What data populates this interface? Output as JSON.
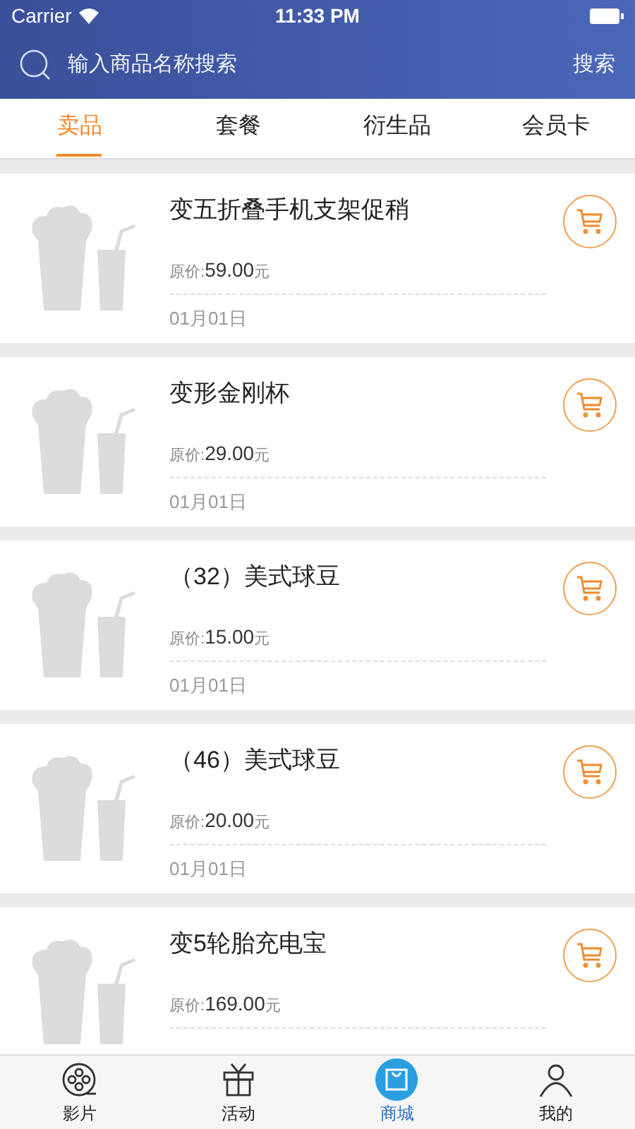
{
  "status_bar": {
    "carrier": "Carrier",
    "time": "11:33 PM"
  },
  "search": {
    "placeholder": "输入商品名称搜索",
    "button": "搜索"
  },
  "tabs": [
    {
      "label": "卖品",
      "selected": true
    },
    {
      "label": "套餐",
      "selected": false
    },
    {
      "label": "衍生品",
      "selected": false
    },
    {
      "label": "会员卡",
      "selected": false
    }
  ],
  "products": [
    {
      "name": "变五折叠手机支架促稍",
      "price_label": "原价:",
      "price": "59.00",
      "unit": "元",
      "date": "01月01日"
    },
    {
      "name": "变形金刚杯",
      "price_label": "原价:",
      "price": "29.00",
      "unit": "元",
      "date": "01月01日"
    },
    {
      "name": "（32）美式球豆",
      "price_label": "原价:",
      "price": "15.00",
      "unit": "元",
      "date": "01月01日"
    },
    {
      "name": "（46）美式球豆",
      "price_label": "原价:",
      "price": "20.00",
      "unit": "元",
      "date": "01月01日"
    },
    {
      "name": "变5轮胎充电宝",
      "price_label": "原价:",
      "price": "169.00",
      "unit": "元"
    }
  ],
  "tab_bar": [
    {
      "label": "影片",
      "selected": false
    },
    {
      "label": "活动",
      "selected": false
    },
    {
      "label": "商城",
      "selected": true
    },
    {
      "label": "我的",
      "selected": false
    }
  ]
}
